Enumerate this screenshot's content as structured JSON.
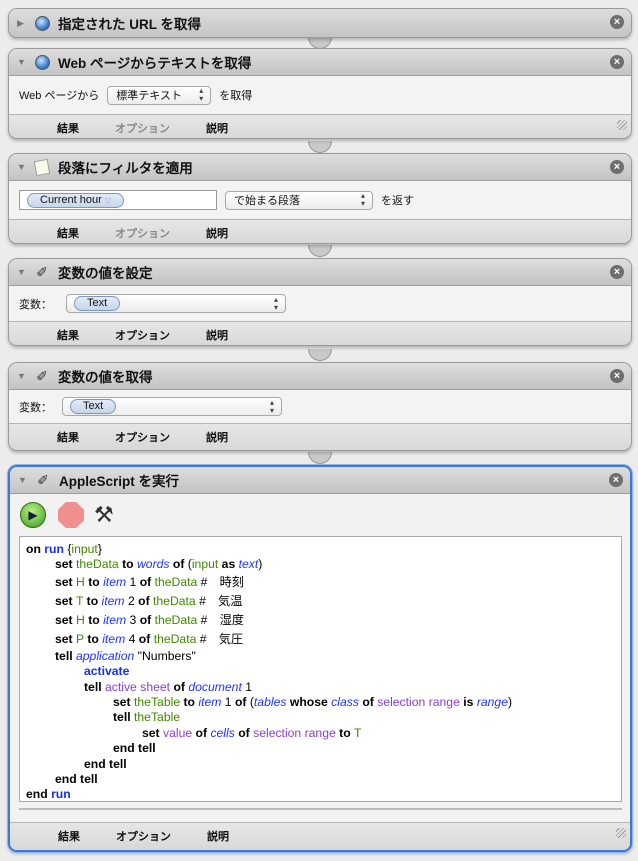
{
  "actions": [
    {
      "title": "指定された URL を取得",
      "icon": "safari-compass-icon",
      "collapsed": true
    },
    {
      "title": "Web ページからテキストを取得",
      "icon": "safari-compass-icon",
      "label_before": "Web ページから",
      "popup": "標準テキスト",
      "label_after": "を取得"
    },
    {
      "title": "段落にフィルタを適用",
      "icon": "text-filter-icon",
      "field_token": "Current hour",
      "popup": "で始まる段落",
      "label_after": "を返す"
    },
    {
      "title": "変数の値を設定",
      "icon": "automator-robot-icon",
      "label": "変数：",
      "variable": "Text"
    },
    {
      "title": "変数の値を取得",
      "icon": "automator-robot-icon",
      "label": "変数：",
      "variable": "Text"
    },
    {
      "title": "AppleScript を実行",
      "icon": "automator-robot-icon"
    }
  ],
  "footer": {
    "results": "結果",
    "options": "オプション",
    "description": "説明"
  },
  "close_glyph": "×",
  "code": [
    {
      "indent": 0,
      "tokens": [
        [
          "on ",
          "kw"
        ],
        [
          "run ",
          "bk"
        ],
        [
          "{",
          "pl"
        ],
        [
          "input",
          "var"
        ],
        [
          "}",
          "pl"
        ]
      ]
    },
    {
      "indent": 1,
      "tokens": [
        [
          "set ",
          "kw"
        ],
        [
          "theData ",
          "var"
        ],
        [
          "to ",
          "kw"
        ],
        [
          "words ",
          "cls"
        ],
        [
          "of ",
          "kw"
        ],
        [
          "(",
          "pl"
        ],
        [
          "input ",
          "var"
        ],
        [
          "as ",
          "kw"
        ],
        [
          "text",
          "cls"
        ],
        [
          ")",
          "pl"
        ]
      ]
    },
    {
      "indent": 1,
      "tokens": [
        [
          "set ",
          "kw"
        ],
        [
          "H ",
          "var"
        ],
        [
          "to ",
          "kw"
        ],
        [
          "item ",
          "cls"
        ],
        [
          "1 ",
          "pl"
        ],
        [
          "of ",
          "kw"
        ],
        [
          "theData ",
          "var"
        ],
        [
          "#　時刻",
          "pl"
        ]
      ]
    },
    {
      "indent": 1,
      "tokens": [
        [
          "set ",
          "kw"
        ],
        [
          "T ",
          "var"
        ],
        [
          "to ",
          "kw"
        ],
        [
          "item ",
          "cls"
        ],
        [
          "2 ",
          "pl"
        ],
        [
          "of ",
          "kw"
        ],
        [
          "theData ",
          "var"
        ],
        [
          "#　気温",
          "pl"
        ]
      ]
    },
    {
      "indent": 1,
      "tokens": [
        [
          "set ",
          "kw"
        ],
        [
          "H ",
          "var"
        ],
        [
          "to ",
          "kw"
        ],
        [
          "item ",
          "cls"
        ],
        [
          "3 ",
          "pl"
        ],
        [
          "of ",
          "kw"
        ],
        [
          "theData ",
          "var"
        ],
        [
          "#　湿度",
          "pl"
        ]
      ]
    },
    {
      "indent": 1,
      "tokens": [
        [
          "set ",
          "kw"
        ],
        [
          "P ",
          "var"
        ],
        [
          "to ",
          "kw"
        ],
        [
          "item ",
          "cls"
        ],
        [
          "4 ",
          "pl"
        ],
        [
          "of ",
          "kw"
        ],
        [
          "theData ",
          "var"
        ],
        [
          "#　気圧",
          "pl"
        ]
      ]
    },
    {
      "indent": 1,
      "tokens": [
        [
          "tell ",
          "kw"
        ],
        [
          "application ",
          "cls"
        ],
        [
          "\"Numbers\"",
          "pl"
        ]
      ]
    },
    {
      "indent": 2,
      "tokens": [
        [
          "activate",
          "bk"
        ]
      ]
    },
    {
      "indent": 2,
      "tokens": [
        [
          "tell ",
          "kw"
        ],
        [
          "active sheet ",
          "prop"
        ],
        [
          "of ",
          "kw"
        ],
        [
          "document ",
          "cls"
        ],
        [
          "1",
          "pl"
        ]
      ]
    },
    {
      "indent": 3,
      "tokens": [
        [
          "set ",
          "kw"
        ],
        [
          "theTable ",
          "var"
        ],
        [
          "to ",
          "kw"
        ],
        [
          "item ",
          "cls"
        ],
        [
          "1 ",
          "pl"
        ],
        [
          "of ",
          "kw"
        ],
        [
          "(",
          "pl"
        ],
        [
          "tables ",
          "cls"
        ],
        [
          "whose ",
          "kw"
        ],
        [
          "class ",
          "cls"
        ],
        [
          "of ",
          "kw"
        ],
        [
          "selection range ",
          "prop"
        ],
        [
          "is ",
          "kw"
        ],
        [
          "range",
          "cls"
        ],
        [
          ")",
          "pl"
        ]
      ]
    },
    {
      "indent": 3,
      "tokens": [
        [
          "tell ",
          "kw"
        ],
        [
          "theTable",
          "var"
        ]
      ]
    },
    {
      "indent": 4,
      "tokens": [
        [
          "set ",
          "kw"
        ],
        [
          "value ",
          "prop"
        ],
        [
          "of ",
          "kw"
        ],
        [
          "cells ",
          "cls"
        ],
        [
          "of ",
          "kw"
        ],
        [
          "selection range ",
          "prop"
        ],
        [
          "to ",
          "kw"
        ],
        [
          "T",
          "var"
        ]
      ]
    },
    {
      "indent": 3,
      "tokens": [
        [
          "end tell",
          "kw"
        ]
      ]
    },
    {
      "indent": 2,
      "tokens": [
        [
          "end tell",
          "kw"
        ]
      ]
    },
    {
      "indent": 1,
      "tokens": [
        [
          "end tell",
          "kw"
        ]
      ]
    },
    {
      "indent": 0,
      "tokens": [
        [
          "end ",
          "kw"
        ],
        [
          "run",
          "bk"
        ]
      ]
    }
  ]
}
